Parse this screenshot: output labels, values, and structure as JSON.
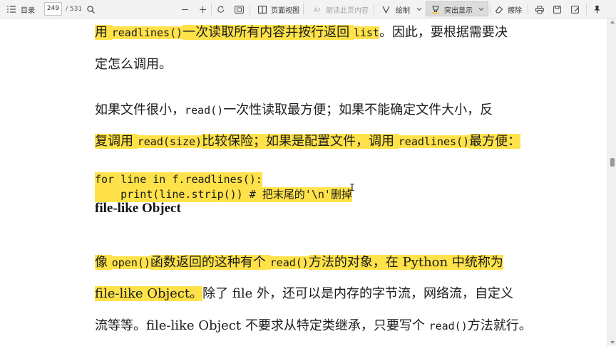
{
  "toolbar": {
    "toc_label": "目录",
    "page_current": "249",
    "page_total": "/ 531",
    "page_view_label": "页面视图",
    "read_aloud_label": "朗读此页内容",
    "draw_label": "绘制",
    "highlight_label": "突出显示",
    "erase_label": "擦除"
  },
  "content": {
    "p1_l1": [
      {
        "t": "用 ",
        "hl": true
      },
      {
        "t": "readlines()",
        "hl": true,
        "code": true
      },
      {
        "t": "一次读取所有内容并按行返回 ",
        "hl": true
      },
      {
        "t": "list",
        "hl": true,
        "code": true
      },
      {
        "t": "。因此，要根据需要决",
        "hl": false
      }
    ],
    "p1_l2": [
      {
        "t": "定怎么调用。",
        "hl": false
      }
    ],
    "p2_l1": [
      {
        "t": "如果文件很小，",
        "hl": false
      },
      {
        "t": "read()",
        "hl": false,
        "code": true
      },
      {
        "t": "一次性读取最方便；如果不能确定文件大小，反",
        "hl": false
      }
    ],
    "p2_l2": [
      {
        "t": "复调用 ",
        "hl": true
      },
      {
        "t": "read(size)",
        "hl": true,
        "code": true
      },
      {
        "t": "比较保险；如果是配置文件，调用 ",
        "hl": true
      },
      {
        "t": "readlines()",
        "hl": true,
        "code": true
      },
      {
        "t": "最方便：",
        "hl": true
      }
    ],
    "code_l1": "for line in f.readlines():",
    "code_l2": "    print(line.strip()) # 把末尾的'\\n'删掉",
    "heading": "file-like Object",
    "p3_l1": [
      {
        "t": "像 ",
        "hl": true
      },
      {
        "t": "open()",
        "hl": true,
        "code": true
      },
      {
        "t": "函数返回的这种有个 ",
        "hl": true
      },
      {
        "t": "read()",
        "hl": true,
        "code": true
      },
      {
        "t": "方法的对象，在 Python 中统称为",
        "hl": true
      }
    ],
    "p3_l2": [
      {
        "t": "file-like Object。",
        "hl": true
      },
      {
        "t": "除了 file 外，还可以是内存的字节流，网络流，自定义",
        "hl": false
      }
    ],
    "p3_l3": [
      {
        "t": "流等等。file-like Object 不要求从特定类继承，只要写个 ",
        "hl": false
      },
      {
        "t": "read()",
        "hl": false,
        "code": true
      },
      {
        "t": "方法就行。",
        "hl": false
      }
    ]
  },
  "colors": {
    "highlight": "#ffe24a"
  }
}
